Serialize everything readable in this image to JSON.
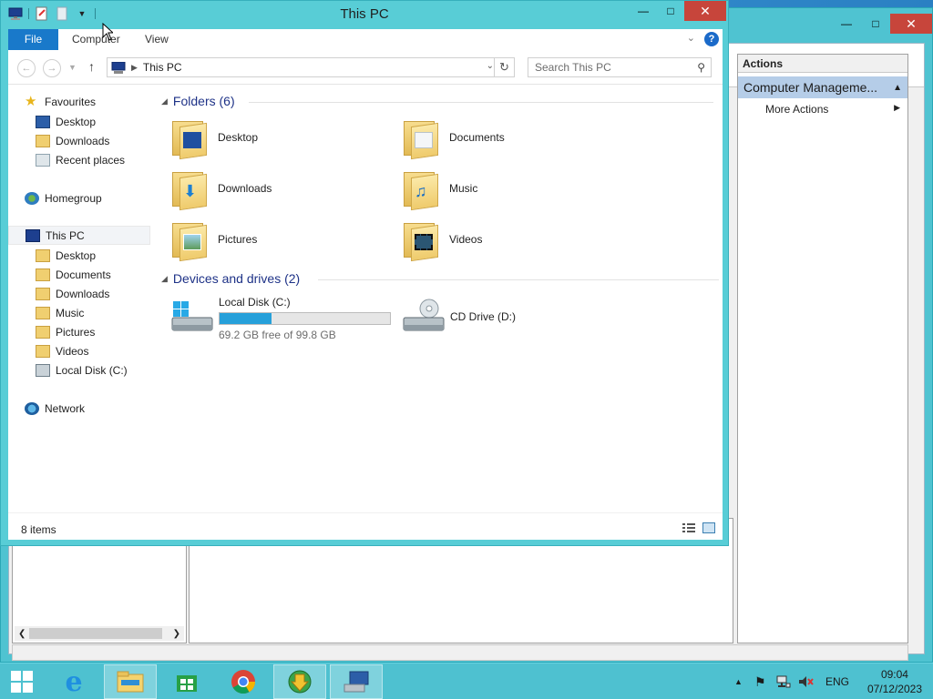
{
  "background_window": {
    "actions_header": "Actions",
    "actions_section": "Computer Manageme...",
    "more_actions": "More Actions"
  },
  "explorer": {
    "title": "This PC",
    "ribbon_tabs": {
      "file": "File",
      "computer": "Computer",
      "view": "View"
    },
    "help": "?",
    "address": {
      "location": "This PC"
    },
    "search": {
      "placeholder": "Search This PC"
    },
    "nav": {
      "favourites": "Favourites",
      "fav_desktop": "Desktop",
      "fav_downloads": "Downloads",
      "fav_recent": "Recent places",
      "homegroup": "Homegroup",
      "this_pc": "This PC",
      "pc_desktop": "Desktop",
      "pc_documents": "Documents",
      "pc_downloads": "Downloads",
      "pc_music": "Music",
      "pc_pictures": "Pictures",
      "pc_videos": "Videos",
      "pc_local_disk": "Local Disk (C:)",
      "network": "Network"
    },
    "folders_header": "Folders (6)",
    "folders": [
      "Desktop",
      "Documents",
      "Downloads",
      "Music",
      "Pictures",
      "Videos"
    ],
    "devices_header": "Devices and drives (2)",
    "drive_c": {
      "name": "Local Disk (C:)",
      "free_text": "69.2 GB free of 99.8 GB",
      "used_fraction": 0.307
    },
    "drive_d": {
      "name": "CD Drive (D:)"
    },
    "status": "8 items"
  },
  "taskbar": {
    "lang": "ENG",
    "time": "09:04",
    "date": "07/12/2023"
  },
  "colors": {
    "window_frame": "#58cdd6",
    "close_button": "#c7453b",
    "file_tab": "#1979ca",
    "group_header": "#1e3287",
    "drive_fill": "#26a0da"
  }
}
